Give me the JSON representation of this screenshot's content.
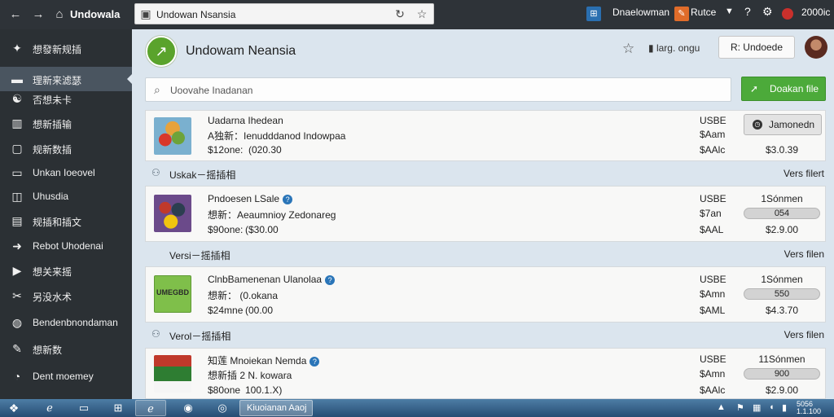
{
  "app": {
    "name": "Undowala"
  },
  "browser": {
    "url_text": "Undowan Nsansia"
  },
  "top_right": {
    "link1": "Dnaelowman",
    "link2": "Rutce",
    "count": "2000ic"
  },
  "sidebar": {
    "items": [
      {
        "label": "想發新规插",
        "icon": "compass-icon",
        "glyph": "✦"
      },
      {
        "label": "理新来滤瑟",
        "icon": "display-icon",
        "glyph": "▬",
        "active": true
      },
      {
        "label": "否想未卡",
        "icon": "people-icon",
        "glyph": "☯"
      },
      {
        "label": "想新插输",
        "icon": "chart-icon",
        "glyph": "▥"
      },
      {
        "label": "规新数插",
        "icon": "frame-icon",
        "glyph": "▢"
      },
      {
        "label": "Unkan Ioeovel",
        "icon": "monitor-icon",
        "glyph": "▭"
      },
      {
        "label": "Uhusdia",
        "icon": "square-icon",
        "glyph": "◫"
      },
      {
        "label": "规插和插文",
        "icon": "terminal-icon",
        "glyph": "▤"
      },
      {
        "label": "Rebot Uhodenai",
        "icon": "arrow-right-icon",
        "glyph": "➜"
      },
      {
        "label": "想关来摇",
        "icon": "play-icon",
        "glyph": "▶"
      },
      {
        "label": "另没水术",
        "icon": "tools-icon",
        "glyph": "✂"
      },
      {
        "label": "Bendenbnondaman",
        "icon": "globe-icon",
        "glyph": "◍"
      },
      {
        "label": "想新数",
        "icon": "pencil-icon",
        "glyph": "✎"
      },
      {
        "label": "Dent moemey",
        "icon": "gauge-icon",
        "glyph": "◔"
      }
    ]
  },
  "header": {
    "title": "Undowam Neansia",
    "lang": "larg. ongu",
    "user_button": "R: Undoede"
  },
  "search": {
    "placeholder": "Uoovahe Inadanan"
  },
  "primary_button": {
    "label": "Doakan file"
  },
  "cards": [
    {
      "title": "Uadarna Ihedean",
      "line2": "A独新：Ienudddanod Indowpaa",
      "price_label": "$12one:",
      "price_val": "(020.30",
      "colA": [
        "USBE",
        "$Aam",
        "$AAlc"
      ],
      "button": "Jamonedn",
      "colB_last": "$3.0.39",
      "thumb": "fruit"
    },
    {
      "title": "Pndoesen LSale",
      "line2": "想新：Aeaumnioy Zedonareg",
      "price_label": "$90one:",
      "price_val": "($30.00",
      "colA": [
        "USBE",
        "$7an",
        "$AAL"
      ],
      "colB_top": "1Sónmen",
      "pill": "054",
      "colB_last": "$2.9.00",
      "thumb": "photo",
      "help": true
    },
    {
      "title": "ClnbBamenenan Ulanolaa",
      "line2": "想新： (0.okana",
      "price_label": "$24mne",
      "price_val": "(00.00",
      "colA": [
        "USBE",
        "$Amn",
        "$AML"
      ],
      "colB_top": "1Sónmen",
      "pill": "550",
      "colB_last": "$4.3.70",
      "thumb": "brand",
      "thumb_text": "UMEGBD",
      "help": true
    },
    {
      "title": "知莲 Mnoiekan Nemda",
      "line2": "想新插 2 N. kowara",
      "price_label": "$80one",
      "price_val": "100.1.X)",
      "colA": [
        "USBE",
        "$Amn",
        "$AAlc"
      ],
      "colB_top": "11Sónmen",
      "pill": "900",
      "colB_last": "$2.9.00",
      "thumb": "box",
      "help": true
    }
  ],
  "sections": [
    {
      "title": "Uskak－摇插相",
      "link": "Vers filert"
    },
    {
      "title": "Versi－摇插相",
      "link": "Vers filen"
    },
    {
      "title": "Verol－摇插相",
      "link": "Vers filen"
    }
  ],
  "taskbar": {
    "active_task": "Kiuoianan Aaoj",
    "clock_line1": "5056",
    "clock_line2": "1.1.100"
  }
}
